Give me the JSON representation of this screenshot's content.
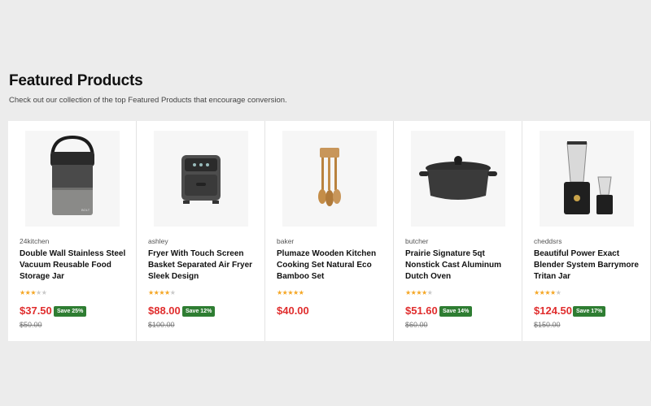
{
  "section": {
    "title": "Featured Products",
    "subtitle": "Check out our collection of the top Featured Products that encourage conversion."
  },
  "colors": {
    "price": "#e02d2d",
    "badge": "#2e7d32",
    "star": "#f5a623"
  },
  "products": [
    {
      "vendor": "24kitchen",
      "name": "Double Wall Stainless Steel Vacuum Reusable Food Storage Jar",
      "rating": 3,
      "price": "$37.50",
      "save": "Save 25%",
      "compare_price": "$50.00",
      "image_icon": "food-jar-icon"
    },
    {
      "vendor": "ashley",
      "name": "Fryer With Touch Screen Basket Separated Air Fryer Sleek Design",
      "rating": 4,
      "price": "$88.00",
      "save": "Save 12%",
      "compare_price": "$100.00",
      "image_icon": "air-fryer-icon"
    },
    {
      "vendor": "baker",
      "name": "Plumaze Wooden Kitchen Cooking Set Natural Eco Bamboo Set",
      "rating": 5,
      "price": "$40.00",
      "save": "",
      "compare_price": "",
      "image_icon": "wooden-utensils-icon"
    },
    {
      "vendor": "butcher",
      "name": "Prairie Signature 5qt Nonstick Cast Aluminum Dutch Oven",
      "rating": 4,
      "price": "$51.60",
      "save": "Save 14%",
      "compare_price": "$60.00",
      "image_icon": "dutch-oven-icon"
    },
    {
      "vendor": "cheddsrs",
      "name": "Beautiful Power Exact Blender System Barrymore Tritan Jar",
      "rating": 4,
      "price": "$124.50",
      "save": "Save 17%",
      "compare_price": "$150.00",
      "image_icon": "blender-icon"
    }
  ]
}
